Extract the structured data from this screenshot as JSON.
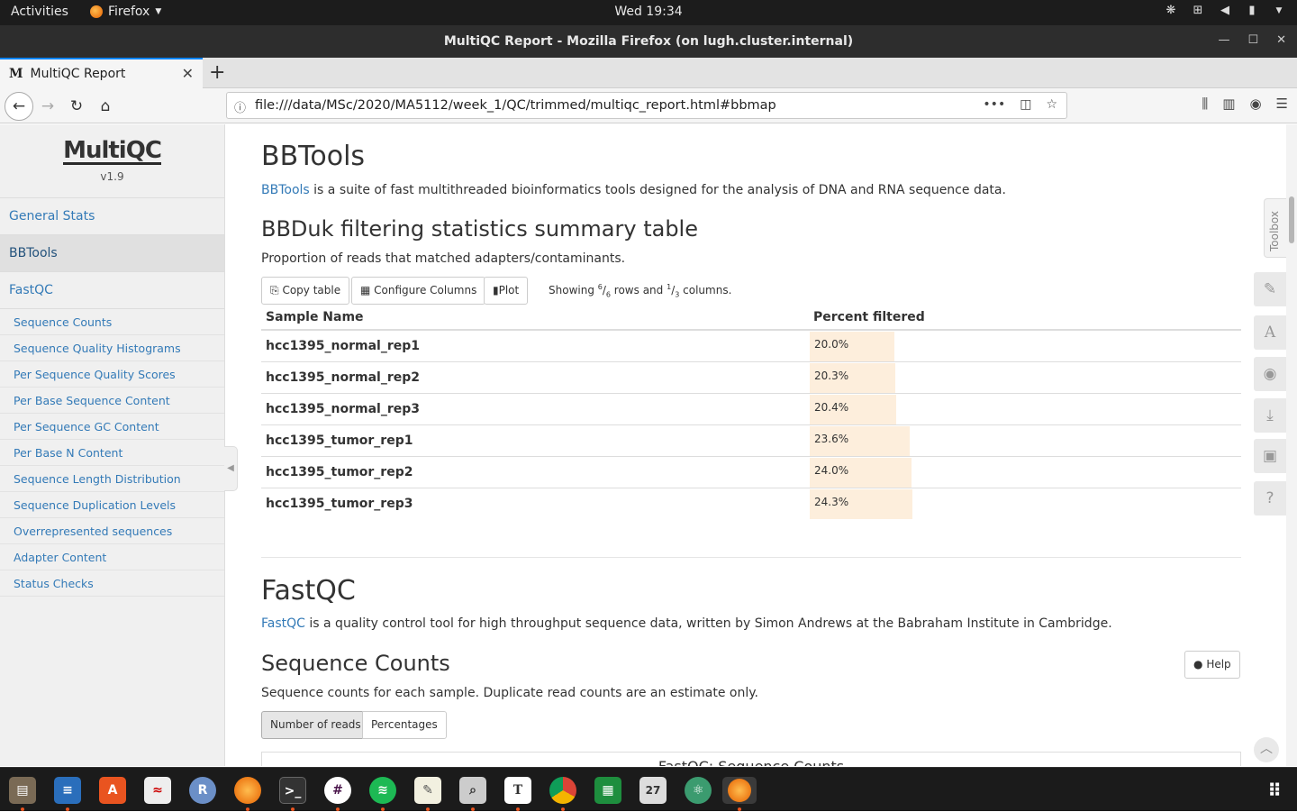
{
  "os": {
    "activities": "Activities",
    "app_name": "Firefox",
    "clock": "Wed 19:34"
  },
  "window": {
    "title": "MultiQC Report - Mozilla Firefox (on lugh.cluster.internal)"
  },
  "browser": {
    "tab_title": "MultiQC Report",
    "tab_favicon": "M",
    "url": "file:///data/MSc/2020/MA5112/week_1/QC/trimmed/multiqc_report.html#bbmap"
  },
  "sidebar": {
    "logo": "MultiQC",
    "version": "v1.9",
    "main_items": [
      "General Stats",
      "BBTools",
      "FastQC"
    ],
    "active": "BBTools",
    "sub_items": [
      "Sequence Counts",
      "Sequence Quality Histograms",
      "Per Sequence Quality Scores",
      "Per Base Sequence Content",
      "Per Sequence GC Content",
      "Per Base N Content",
      "Sequence Length Distribution",
      "Sequence Duplication Levels",
      "Overrepresented sequences",
      "Adapter Content",
      "Status Checks"
    ]
  },
  "bbtools": {
    "heading": "BBTools",
    "link": "BBTools",
    "desc": " is a suite of fast multithreaded bioinformatics tools designed for the analysis of DNA and RNA sequence data.",
    "table_heading": "BBDuk filtering statistics summary table",
    "table_desc": "Proportion of reads that matched adapters/contaminants.",
    "btn_copy": "Copy table",
    "btn_configure": "Configure Columns",
    "btn_plot": "Plot",
    "showing_prefix": "Showing ",
    "rows_shown": "6",
    "rows_total": "6",
    "rows_word": " rows and ",
    "cols_shown": "1",
    "cols_total": "3",
    "cols_word": " columns.",
    "col_sample": "Sample Name",
    "col_percent": "Percent filtered",
    "bar_max_pct": 100,
    "rows": [
      {
        "sample": "hcc1395_normal_rep1",
        "value": "20.0%",
        "pct": 20.0
      },
      {
        "sample": "hcc1395_normal_rep2",
        "value": "20.3%",
        "pct": 20.3
      },
      {
        "sample": "hcc1395_normal_rep3",
        "value": "20.4%",
        "pct": 20.4
      },
      {
        "sample": "hcc1395_tumor_rep1",
        "value": "23.6%",
        "pct": 23.6
      },
      {
        "sample": "hcc1395_tumor_rep2",
        "value": "24.0%",
        "pct": 24.0
      },
      {
        "sample": "hcc1395_tumor_rep3",
        "value": "24.3%",
        "pct": 24.3
      }
    ]
  },
  "fastqc": {
    "heading": "FastQC",
    "link": "FastQC",
    "desc": " is a quality control tool for high throughput sequence data, written by Simon Andrews at the Babraham Institute in Cambridge.",
    "seq_counts_heading": "Sequence Counts",
    "help_btn": "Help",
    "seq_counts_desc": "Sequence counts for each sample. Duplicate read counts are an estimate only.",
    "btn_reads": "Number of reads",
    "btn_percent": "Percentages",
    "plot_title": "FastQC: Sequence Counts"
  },
  "toolbox": {
    "label": "Toolbox"
  },
  "colors": {
    "link": "#337ab7",
    "bar": "#fdeedc",
    "dock_indicator": "#e95420"
  },
  "dock": [
    "files-icon",
    "writer-icon",
    "software-icon",
    "evince-icon",
    "r-icon",
    "firefox-icon",
    "terminal-icon",
    "slack-icon",
    "spotify-icon",
    "text-editor-icon",
    "image-viewer-icon",
    "typora-icon",
    "chrome-icon",
    "calc-icon",
    "calendar-icon",
    "atom-icon",
    "firefox-active-icon",
    "app-grid-icon"
  ]
}
